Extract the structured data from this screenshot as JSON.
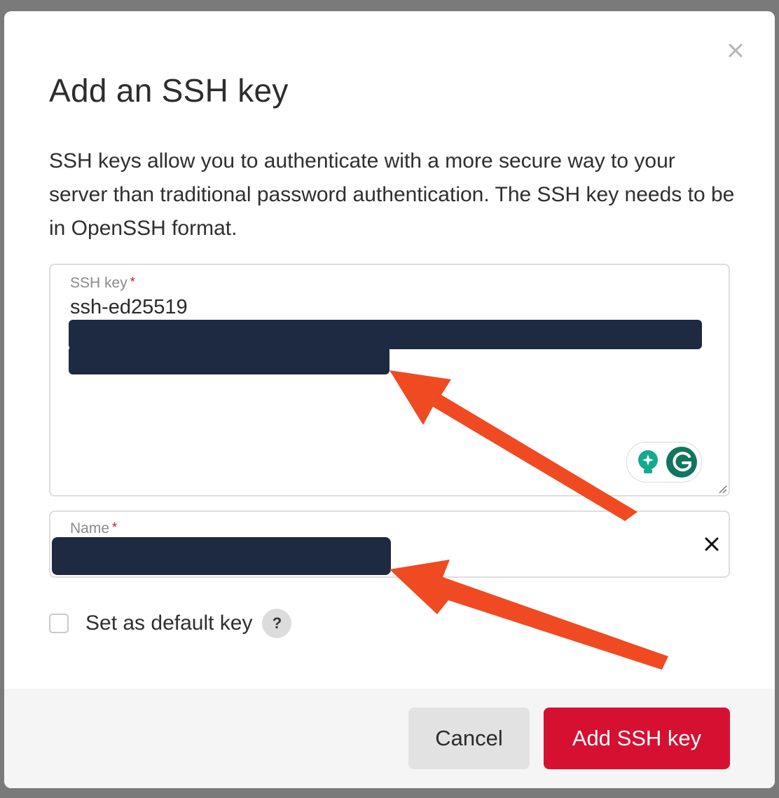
{
  "dialog": {
    "title": "Add an SSH key",
    "description": "SSH keys allow you to authenticate with a more secure way to your server than traditional password authentication. The SSH key needs to be in OpenSSH format."
  },
  "ssh_key_field": {
    "label": "SSH key",
    "required_mark": "*",
    "value_prefix": "ssh-ed25519"
  },
  "name_field": {
    "label": "Name",
    "required_mark": "*"
  },
  "default_key": {
    "label": "Set as default key",
    "checked": false,
    "help_glyph": "?"
  },
  "footer": {
    "cancel_label": "Cancel",
    "submit_label": "Add SSH key"
  },
  "icons": {
    "close": "close-icon",
    "clear": "clear-icon",
    "help": "help-icon",
    "grammarly": "grammarly-icon",
    "lightbulb": "lightbulb-icon",
    "resize": "resize-handle-icon"
  },
  "colors": {
    "accent": "#d61031",
    "redaction": "#1e2a42",
    "annotation_arrow": "#f04a23",
    "grammarly_green": "#15a98e",
    "grammarly_teal": "#11765f"
  }
}
